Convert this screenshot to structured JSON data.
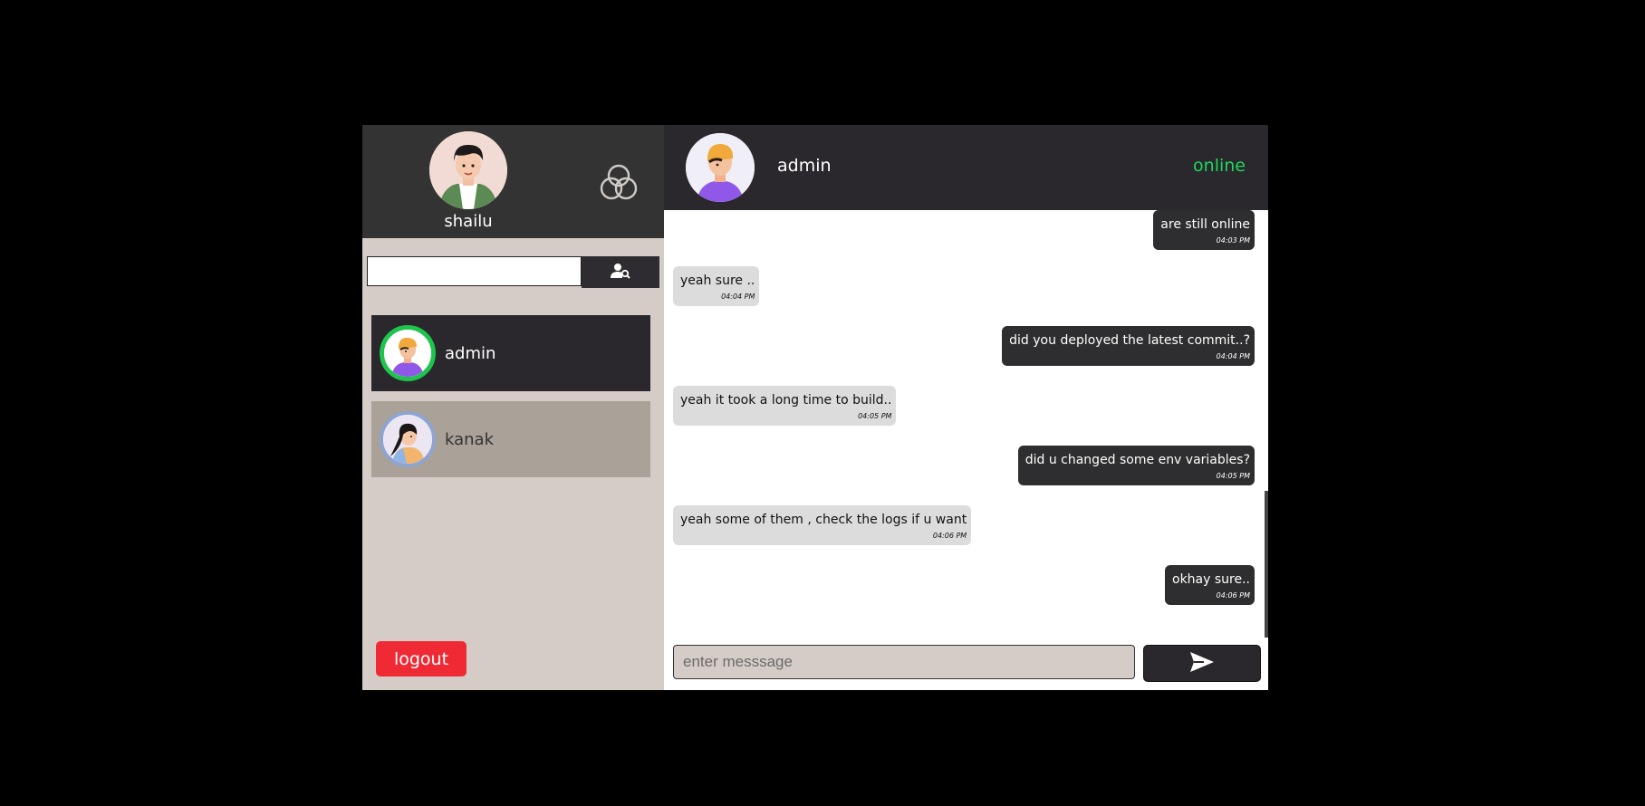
{
  "sidebar": {
    "profile": {
      "username": "shailu",
      "avatar_icon": "male-avatar-icon",
      "menu_icon": "rings-icon"
    },
    "search": {
      "value": "",
      "placeholder": "",
      "button_icon": "user-search-icon"
    },
    "contacts": [
      {
        "name": "admin",
        "avatar_icon": "admin-avatar-icon",
        "active": true
      },
      {
        "name": "kanak",
        "avatar_icon": "female-avatar-icon",
        "active": false
      }
    ],
    "logout_label": "logout"
  },
  "chat": {
    "header": {
      "name": "admin",
      "status": "online"
    },
    "messages": [
      {
        "direction": "sent",
        "text": "are still online",
        "time": "04:03 PM"
      },
      {
        "direction": "received",
        "text": "yeah sure ..",
        "time": "04:04 PM"
      },
      {
        "direction": "sent",
        "text": "did you deployed the latest commit..?",
        "time": "04:04 PM"
      },
      {
        "direction": "received",
        "text": "yeah it took a long time to build..",
        "time": "04:05 PM"
      },
      {
        "direction": "sent",
        "text": "did u changed some env variables?",
        "time": "04:05 PM"
      },
      {
        "direction": "received",
        "text": "yeah some of them , check the logs if u want",
        "time": "04:06 PM"
      },
      {
        "direction": "sent",
        "text": "okhay sure..",
        "time": "04:06 PM"
      }
    ],
    "composer": {
      "placeholder": "enter messsage",
      "value": "",
      "send_icon": "send-icon"
    }
  },
  "colors": {
    "online": "#1ed85c",
    "logout": "#ef2a35",
    "dark_panel": "#2a272d",
    "sidebar_bg": "#d5ccc8"
  }
}
